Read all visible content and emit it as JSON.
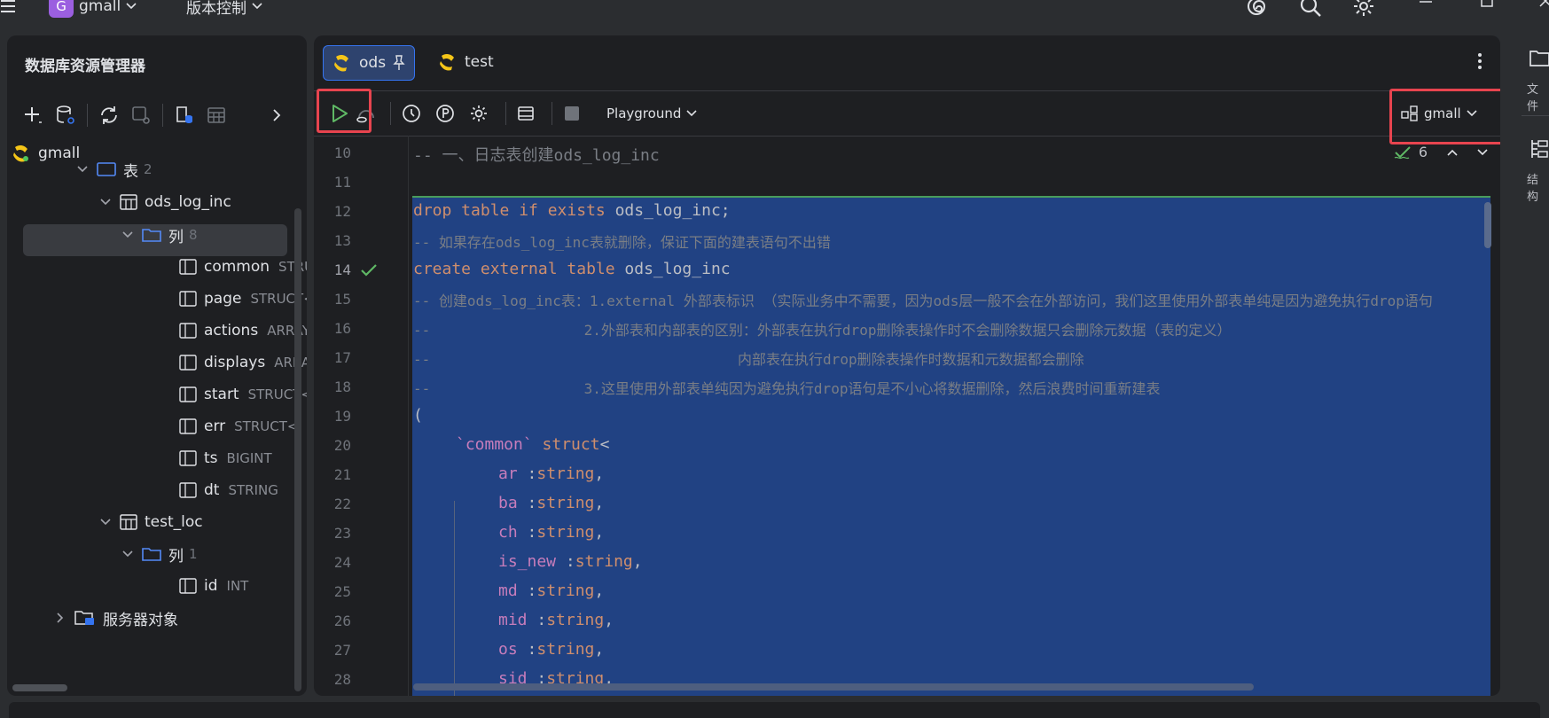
{
  "titlebar": {
    "project_badge": "G",
    "project_name": "gmall",
    "vcs_label": "版本控制"
  },
  "left_panel": {
    "title": "数据库资源管理器",
    "tree": {
      "datasource": "gmall",
      "tables_folder": {
        "label": "表",
        "count": "2"
      },
      "table1": {
        "name": "ods_log_inc"
      },
      "columns_folder1": {
        "label": "列",
        "count": "8"
      },
      "columns1": [
        {
          "name": "common",
          "type": "STRUCT<"
        },
        {
          "name": "page",
          "type": "STRUCT<"
        },
        {
          "name": "actions",
          "type": "ARRAY<"
        },
        {
          "name": "displays",
          "type": "ARRAY<"
        },
        {
          "name": "start",
          "type": "STRUCT<"
        },
        {
          "name": "err",
          "type": "STRUCT<"
        },
        {
          "name": "ts",
          "type": "BIGINT"
        },
        {
          "name": "dt",
          "type": "STRING"
        }
      ],
      "table2": {
        "name": "test_loc"
      },
      "columns_folder2": {
        "label": "列",
        "count": "1"
      },
      "columns2": [
        {
          "name": "id",
          "type": "INT"
        }
      ],
      "server_objects": "服务器对象"
    }
  },
  "editor": {
    "tabs": [
      {
        "label": "ods",
        "active": true,
        "pinned": true
      },
      {
        "label": "test",
        "active": false
      }
    ],
    "toolbar": {
      "session_mode": "Playground",
      "datasource": "gmall"
    },
    "inspection_count": "6",
    "line_numbers": [
      "10",
      "11",
      "12",
      "13",
      "14",
      "15",
      "16",
      "17",
      "18",
      "19",
      "20",
      "21",
      "22",
      "23",
      "24",
      "25",
      "26",
      "27",
      "28"
    ],
    "lines": {
      "l10": "-- 一、日志表创建ods_log_inc",
      "l12_kw1": "drop table if exists",
      "l12_id": " ods_log_inc;",
      "l13": "-- 如果存在ods_log_inc表就删除，保证下面的建表语句不出错",
      "l14_kw1": "create external table",
      "l14_id": " ods_log_inc",
      "l15": "-- 创建ods_log_inc表：1.external 外部表标识 （实际业务中不需要，因为ods层一般不会在外部访问，我们这里使用外部表单纯是因为避免执行drop语句",
      "l16": "--                  2.外部表和内部表的区别：外部表在执行drop删除表操作时不会删除数据只会删除元数据（表的定义）",
      "l17": "--                                    内部表在执行drop删除表操作时数据和元数据都会删除",
      "l18": "--                  3.这里使用外部表单纯因为避免执行drop语句是不小心将数据删除，然后浪费时间重新建表",
      "l19": "(",
      "l20_fld": "`common`",
      "l20_ty": " struct",
      "l20_rest": "<",
      "fields": [
        {
          "name": "ar",
          "sep": " :",
          "type": "string",
          "end": ","
        },
        {
          "name": "ba",
          "sep": " :",
          "type": "string",
          "end": ","
        },
        {
          "name": "ch",
          "sep": " :",
          "type": "string",
          "end": ","
        },
        {
          "name": "is_new",
          "sep": " :",
          "type": "string",
          "end": ","
        },
        {
          "name": "md",
          "sep": " :",
          "type": "string",
          "end": ","
        },
        {
          "name": "mid",
          "sep": " :",
          "type": "string",
          "end": ","
        },
        {
          "name": "os",
          "sep": " :",
          "type": "string",
          "end": ","
        },
        {
          "name": "sid",
          "sep": " :",
          "type": "string",
          "end": ","
        }
      ]
    }
  },
  "right_strip": {
    "files_label": "文件",
    "structure_label": "结构"
  },
  "colors": {
    "selection": "#214283",
    "keyword": "#cf8e6d",
    "comment": "#7a7e85",
    "field": "#c77dbb",
    "highlight_box": "#e8444f",
    "run_green": "#5fb865"
  }
}
